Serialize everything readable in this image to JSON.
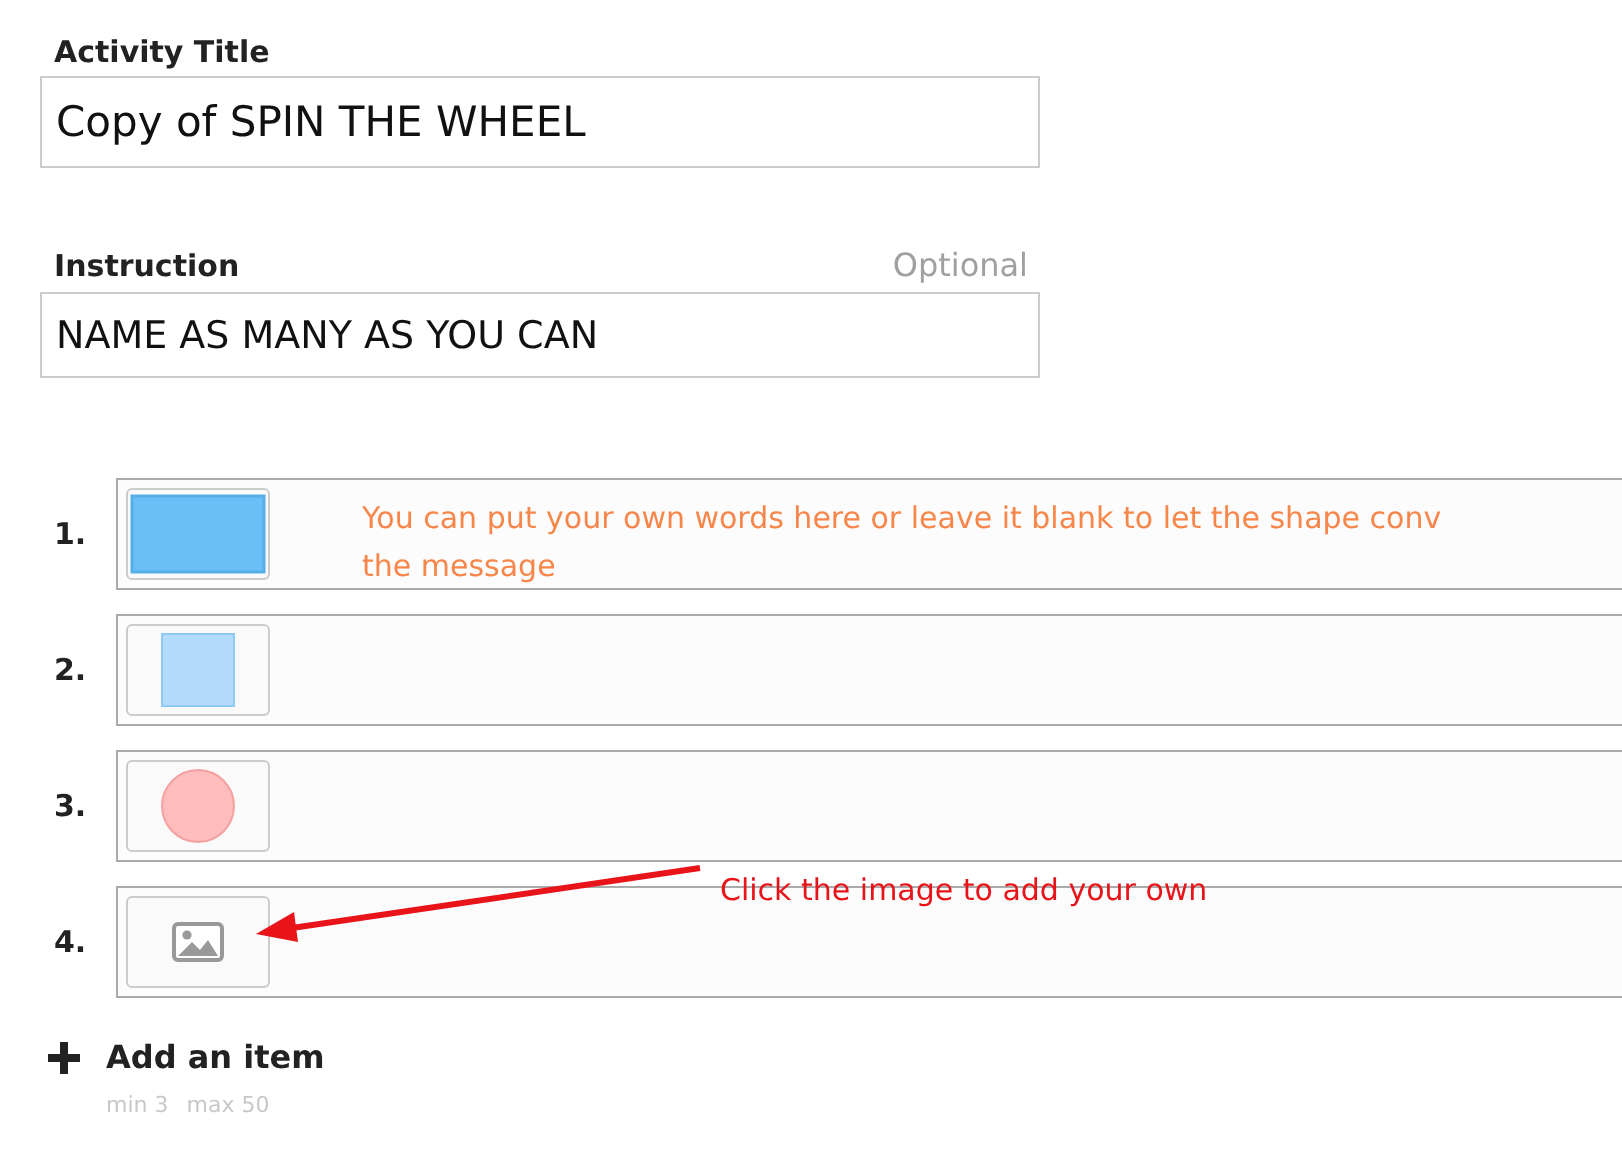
{
  "activity_title": {
    "label": "Activity Title",
    "value": "Copy of SPIN THE WHEEL"
  },
  "instruction": {
    "label": "Instruction",
    "hint": "Optional",
    "value": "NAME AS MANY AS YOU CAN"
  },
  "items": [
    {
      "number": "1.",
      "kind": "rectangle",
      "color": "#6bbff7",
      "note": "You can put your own words here or leave it blank to let the shape conv\nthe message"
    },
    {
      "number": "2.",
      "kind": "square",
      "color": "#b3dcfc"
    },
    {
      "number": "3.",
      "kind": "circle",
      "color": "#ffbcbc"
    },
    {
      "number": "4.",
      "kind": "image"
    }
  ],
  "annotation": {
    "text": "Click the image to add your own"
  },
  "add_item": {
    "label": "Add an item",
    "min": "min 3",
    "max": "max 50"
  }
}
